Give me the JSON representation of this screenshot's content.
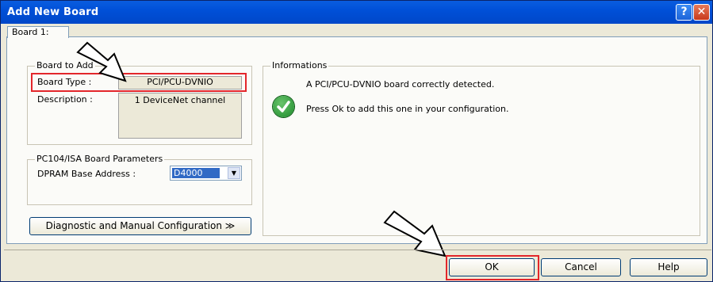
{
  "window": {
    "title": "Add New Board",
    "help_glyph": "?",
    "close_glyph": "✕"
  },
  "tab": {
    "label": "Board 1:"
  },
  "board_to_add": {
    "group_label": "Board to Add",
    "board_type_label": "Board Type :",
    "board_type_value": "PCI/PCU-DVNIO",
    "description_label": "Description :",
    "description_value": "1 DeviceNet channel"
  },
  "pc104": {
    "group_label": "PC104/ISA Board Parameters",
    "dpram_label": "DPRAM Base Address :",
    "dpram_value": "D4000",
    "dropdown_glyph": "▼"
  },
  "diag_button": "Diagnostic and Manual Configuration ≫",
  "informations": {
    "group_label": "Informations",
    "line1": "A PCI/PCU-DVNIO board correctly detected.",
    "line2": "Press Ok to add this one in your configuration.",
    "icon": "checkmark-icon",
    "icon_color": "#1c8a2b"
  },
  "buttons": {
    "ok": "OK",
    "cancel": "Cancel",
    "help": "Help"
  },
  "annotation_color": "#e3262b"
}
